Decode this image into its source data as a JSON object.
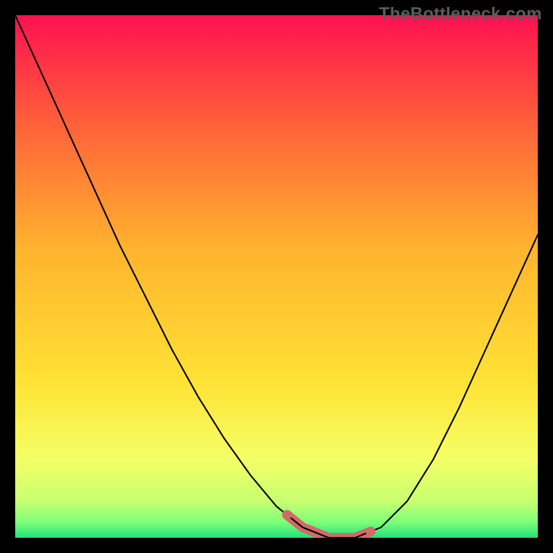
{
  "watermark": "TheBottleneck.com",
  "chart_data": {
    "type": "line",
    "title": "",
    "xlabel": "",
    "ylabel": "",
    "x": [
      0.0,
      0.05,
      0.1,
      0.15,
      0.2,
      0.25,
      0.3,
      0.35,
      0.4,
      0.45,
      0.5,
      0.55,
      0.6,
      0.65,
      0.7,
      0.75,
      0.8,
      0.85,
      0.9,
      0.95,
      1.0
    ],
    "series": [
      {
        "name": "curve",
        "values": [
          1.0,
          0.89,
          0.78,
          0.67,
          0.56,
          0.46,
          0.36,
          0.27,
          0.19,
          0.12,
          0.06,
          0.02,
          0.0,
          0.0,
          0.02,
          0.07,
          0.15,
          0.25,
          0.36,
          0.47,
          0.58
        ]
      }
    ],
    "highlight_range": {
      "x_start": 0.52,
      "x_end": 0.68
    },
    "xlim": [
      0,
      1
    ],
    "ylim": [
      0,
      1
    ],
    "gradient_stops": [
      {
        "offset": 0.0,
        "color": "#ff1051"
      },
      {
        "offset": 0.2,
        "color": "#ff5e3a"
      },
      {
        "offset": 0.45,
        "color": "#ffb42e"
      },
      {
        "offset": 0.7,
        "color": "#ffe234"
      },
      {
        "offset": 0.85,
        "color": "#f4ff66"
      },
      {
        "offset": 0.93,
        "color": "#c8ff70"
      },
      {
        "offset": 0.97,
        "color": "#7dff78"
      },
      {
        "offset": 1.0,
        "color": "#22e07a"
      }
    ],
    "highlight_color": "#d26a6a"
  }
}
